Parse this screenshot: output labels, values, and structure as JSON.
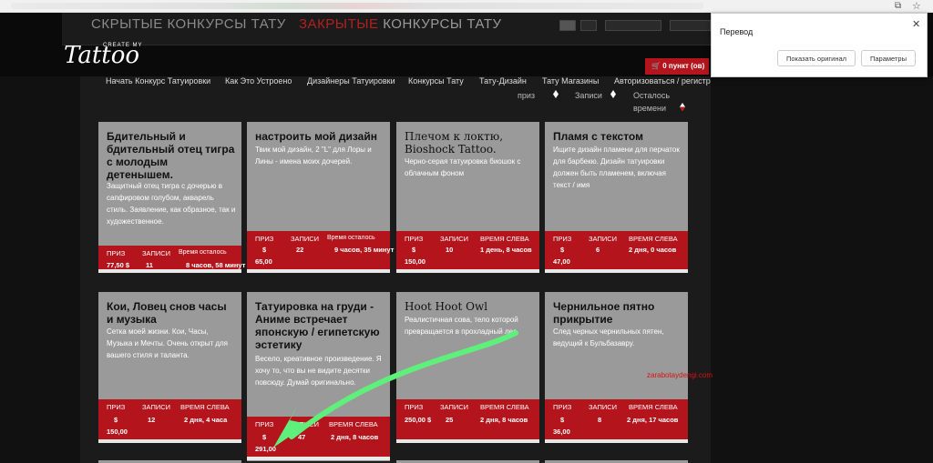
{
  "browser": {
    "translate_icon": "translate-icon",
    "star_icon": "bookmark-star-icon"
  },
  "header": {
    "faded_left": "СКРЫТЫЕ КОНКУРСЫ ТАТУ",
    "faded_right_red": "ЗАКРЫТЫЕ",
    "faded_right": "КОНКУРСЫ ТАТУ",
    "logo_sup": "CREATE MY",
    "logo": "Tattoo",
    "cart": "0 пункт (ов)"
  },
  "nav": [
    "Начать Конкурс Татуировки",
    "Как Это Устроено",
    "Дизайнеры Татуировки",
    "Конкурсы Тату",
    "Тату-Дизайн",
    "Тату Магазины",
    "Авторизоваться / регистр"
  ],
  "sort": {
    "prize": "приз",
    "entries": "Записи",
    "remaining_1": "Осталось",
    "remaining_2": "времени"
  },
  "cards": [
    {
      "title": "Бдительный и бдительный отец тигра с молодым детенышем.",
      "desc": "Защитный отец тигра с дочерью в сапфировом голубом, акварель стиль. Заявление, как образное, так и художественное.",
      "l1": "ПРИЗ",
      "l2": "ЗАПИСИ",
      "l3": "Время осталось",
      "prize_cur": "",
      "prize": "77,50 $",
      "entries": "11",
      "time": "8 часов, 58 минут"
    },
    {
      "title": "настроить мой дизайн",
      "desc": "Твик мой дизайн, 2 \"L\" для Лоры и Лины - имена моих дочерей.",
      "l1": "ПРИЗ",
      "l2": "ЗАПИСИ",
      "l3": "Время осталось",
      "prize_cur": "$",
      "prize": "65,00",
      "entries": "22",
      "time": "9 часов, 35 минут"
    },
    {
      "title": "Плечом к локтю, Bioshock Tattoo.",
      "desc": "Черно-серая татуировка биошок с облачным фоном",
      "l1": "ПРИЗ",
      "l2": "ЗАПИСИ",
      "l3": "ВРЕМЯ СЛЕВА",
      "prize_cur": "$",
      "prize": "150,00",
      "entries": "10",
      "time": "1 день, 8 часов"
    },
    {
      "title": "Пламя с текстом",
      "desc": "Ищите дизайн пламени для перчаток для барбекю. Дизайн татуировки должен быть пламенем, включая текст / имя",
      "l1": "ПРИЗ",
      "l2": "ЗАПИСИ",
      "l3": "ВРЕМЯ СЛЕВА",
      "prize_cur": "$",
      "prize": "47,00",
      "entries": "6",
      "time": "2 дня, 0 часов"
    },
    {
      "title": "Кои, Ловец снов часы и музыка",
      "desc": "Сетка моей жизни. Кои, Часы, Музыка и Мечты. Очень открыт для вашего стиля и таланта.",
      "l1": "ПРИЗ",
      "l2": "ЗАПИСИ",
      "l3": "ВРЕМЯ СЛЕВА",
      "prize_cur": "$",
      "prize": "150,00",
      "entries": "12",
      "time": "2 дня, 4 часа"
    },
    {
      "title": "Татуировка на груди - Аниме встречает японскую / египетскую эстетику",
      "desc": "Весело, креативное произведение. Я хочу то, что вы не видите десятки повсюду. Думай оригинально.",
      "l1": "ПРИЗ",
      "l2": "ЗАПИСИ",
      "l3": "ВРЕМЯ СЛЕВА",
      "prize_cur": "$",
      "prize": "291,00",
      "entries": "47",
      "time": "2 дня, 8 часов"
    },
    {
      "title": "Hoot Hoot Owl",
      "desc": "Реалистичная сова, тело которой превращается в прохладный лес.",
      "l1": "ПРИЗ",
      "l2": "ЗАПИСИ",
      "l3": "ВРЕМЯ СЛЕВА",
      "prize_cur": "",
      "prize": "250,00 $",
      "entries": "25",
      "time": "2 дня, 8 часов"
    },
    {
      "title": "Чернильное пятно прикрытие",
      "desc": "След черных чернильных пятен, ведущий к Бульбазавру.",
      "l1": "ПРИЗ",
      "l2": "ЗАПИСИ",
      "l3": "ВРЕМЯ СЛЕВА",
      "prize_cur": "$",
      "prize": "36,00",
      "entries": "8",
      "time": "2 дня, 17 часов"
    }
  ],
  "watermark": "zarabotaydengi.com",
  "popup": {
    "title": "Перевод",
    "show_original": "Показать оригинал",
    "options": "Параметры",
    "close_icon": "close-icon"
  },
  "colors": {
    "accent_red": "#b4151c",
    "card_gray": "#9a9a9a",
    "arrow_green": "#5ef07a"
  }
}
